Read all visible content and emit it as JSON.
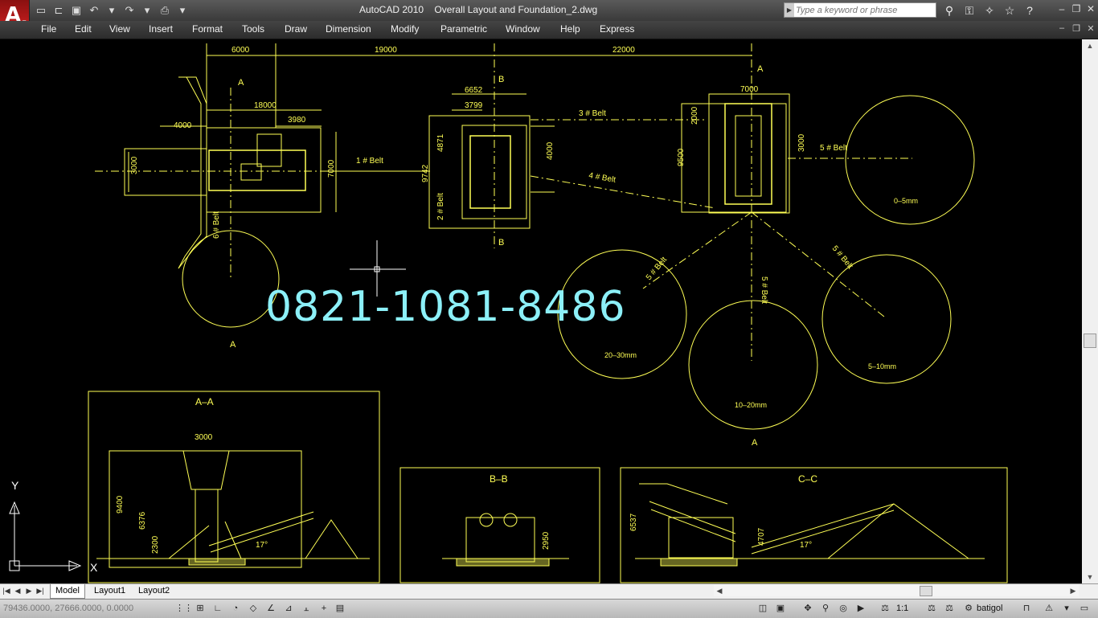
{
  "title": {
    "app": "AutoCAD 2010",
    "file": "Overall Layout and Foundation_2.dwg"
  },
  "search": {
    "placeholder": "Type a keyword or phrase"
  },
  "menu": [
    "File",
    "Edit",
    "View",
    "Insert",
    "Format",
    "Tools",
    "Draw",
    "Dimension",
    "Modify",
    "Parametric",
    "Window",
    "Help",
    "Express"
  ],
  "drawing": {
    "top_dims": [
      "6000",
      "19000",
      "22000"
    ],
    "plan1": {
      "dims": [
        "18000",
        "4000",
        "3980",
        "3000",
        "7000"
      ],
      "belt": "1 # Belt",
      "belt_side": "6 # Belt"
    },
    "plan2": {
      "dims": [
        "6652",
        "3799",
        "4871",
        "9742",
        "4000",
        "2 # Belt"
      ],
      "belt3": "3 # Belt",
      "belt4": "4 # Belt"
    },
    "plan3": {
      "dims": [
        "7000",
        "2000",
        "9500",
        "3000"
      ],
      "belt5": "5 # Belt"
    },
    "section_marks": {
      "a": "A",
      "b": "B"
    },
    "piles": [
      "0–5mm",
      "20–30mm",
      "10–20mm",
      "5–10mm"
    ],
    "pile_belts": [
      "5 # Belt",
      "5 # Belt",
      "5 # Belt"
    ],
    "sections": {
      "aa": {
        "title": "A–A",
        "dims": [
          "3000",
          "9400",
          "6376",
          "2300",
          "17°"
        ]
      },
      "bb": {
        "title": "B–B",
        "dims": [
          "2950"
        ]
      },
      "cc": {
        "title": "C–C",
        "dims": [
          "6537",
          "4707",
          "17°"
        ]
      }
    },
    "ucs": {
      "x": "X",
      "y": "Y"
    },
    "watermark": "0821-1081-8486"
  },
  "tabs": [
    "Model",
    "Layout1",
    "Layout2"
  ],
  "status": {
    "coords": "79436.0000, 27666.0000, 0.0000",
    "scale": "1:1",
    "workspace": "batigol"
  },
  "colors": {
    "drawing_line": "#ffff55",
    "watermark": "#8cf0f8",
    "background": "#000000"
  }
}
